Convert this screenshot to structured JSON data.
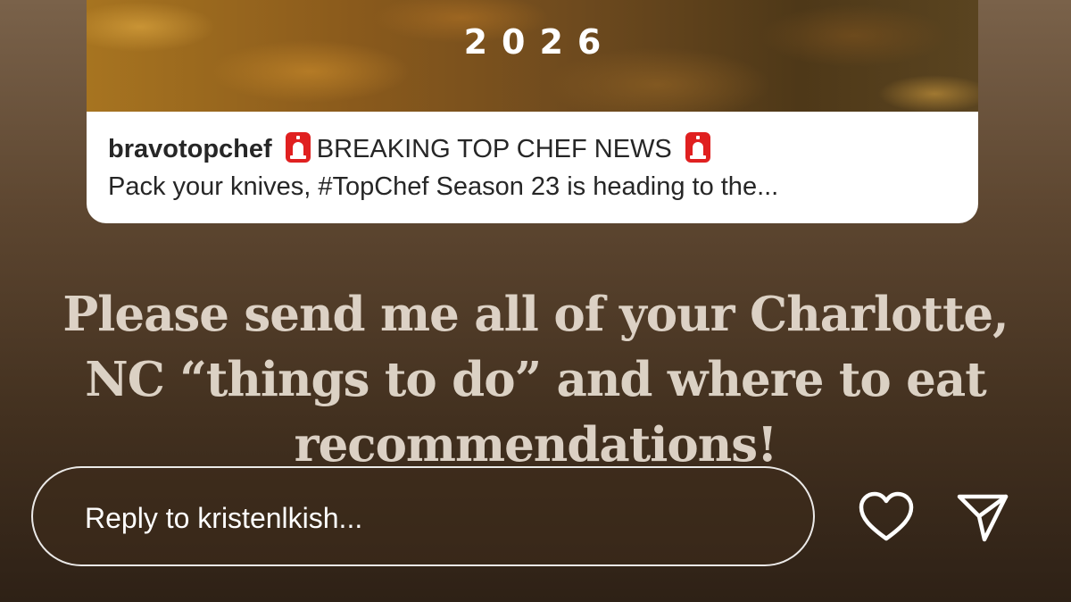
{
  "story": {
    "shared_post": {
      "image_text": "2026",
      "username": "bravotopchef",
      "headline": "BREAKING TOP CHEF NEWS",
      "caption_line2": "Pack your knives, #TopChef Season 23 is heading to the..."
    },
    "overlay_text": "Please send me all of your Charlotte, NC “things to do” and where to eat recommendations!"
  },
  "reply": {
    "placeholder": "Reply to kristenlkish..."
  },
  "icons": {
    "siren": "police-siren-emoji-icon",
    "like": "heart-icon",
    "share": "send-paper-plane-icon"
  },
  "colors": {
    "caption_text": "#262626",
    "story_text": "#e8ded2",
    "siren_red": "#e02020"
  }
}
